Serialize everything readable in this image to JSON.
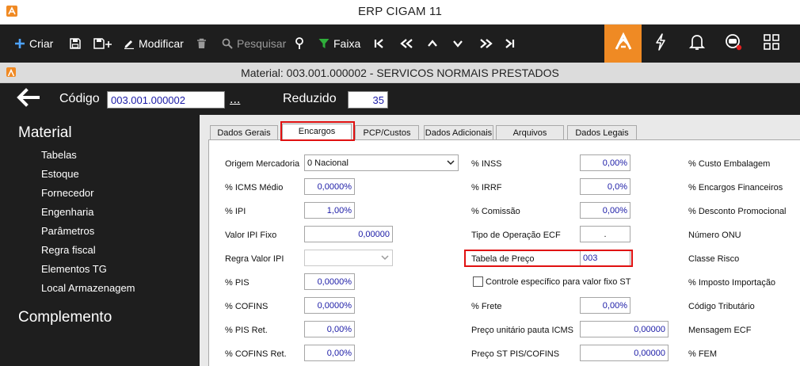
{
  "window": {
    "title": "ERP CIGAM 11"
  },
  "toolbar": {
    "criar": "Criar",
    "modificar": "Modificar",
    "pesquisar": "Pesquisar",
    "faixa": "Faixa",
    "icons": [
      "plus-icon",
      "save-icon",
      "save-add-icon",
      "edit-icon",
      "trash-icon",
      "search-icon",
      "pin-icon",
      "filter-icon",
      "first-icon",
      "prev-fast-icon",
      "up-icon",
      "down-icon",
      "last-icon",
      "cigam-logo-icon",
      "lightning-icon",
      "bell-icon",
      "support-icon",
      "apps-grid-icon"
    ],
    "accent": "#ef8a24"
  },
  "record": {
    "title": "Material: 003.001.000002 - SERVICOS NORMAIS PRESTADOS"
  },
  "codebar": {
    "codigo_label": "Código",
    "codigo_value": "003.001.000002",
    "lookup": "...",
    "reduzido_label": "Reduzido",
    "reduzido_value": "35"
  },
  "sidebar": {
    "section1": "Material",
    "items": [
      "Tabelas",
      "Estoque",
      "Fornecedor",
      "Engenharia",
      "Parâmetros",
      "Regra fiscal",
      "Elementos TG",
      "Local Armazenagem"
    ],
    "section2": "Complemento"
  },
  "tabs": [
    "Dados Gerais",
    "Encargos",
    "PCP/Custos",
    "Dados Adicionais",
    "Arquivos",
    "Dados Legais"
  ],
  "active_tab": "Encargos",
  "form": {
    "col1": {
      "origem_label": "Origem Mercadoria",
      "origem_value": "0 Nacional",
      "icms_label": "% ICMS Médio",
      "icms_value": "0,0000%",
      "ipi_label": "% IPI",
      "ipi_value": "1,00%",
      "ipi_fixo_label": "Valor IPI Fixo",
      "ipi_fixo_value": "0,00000",
      "regra_ipi_label": "Regra Valor IPI",
      "regra_ipi_value": "",
      "pis_label": "% PIS",
      "pis_value": "0,0000%",
      "cofins_label": "% COFINS",
      "cofins_value": "0,0000%",
      "pis_ret_label": "% PIS Ret.",
      "pis_ret_value": "0,00%",
      "cofins_ret_label": "% COFINS Ret.",
      "cofins_ret_value": "0,00%"
    },
    "col2": {
      "inss_label": "% INSS",
      "inss_value": "0,00%",
      "irrf_label": "% IRRF",
      "irrf_value": "0,0%",
      "comissao_label": "% Comissão",
      "comissao_value": "0,00%",
      "tipo_ecf_label": "Tipo de Operação ECF",
      "tipo_ecf_value": ".",
      "tabela_preco_label": "Tabela de Preço",
      "tabela_preco_value": "003",
      "controle_label": "Controle específico para valor fixo ST",
      "frete_label": "% Frete",
      "frete_value": "0,00%",
      "preco_pauta_label": "Preço unitário pauta ICMS",
      "preco_pauta_value": "0,00000",
      "preco_st_label": "Preço ST PIS/COFINS",
      "preco_st_value": "0,00000"
    },
    "col3": {
      "custo_emb": "% Custo Embalagem",
      "encargos_fin": "% Encargos Financeiros",
      "desconto_promo": "% Desconto Promocional",
      "numero_onu": "Número ONU",
      "classe_risco": "Classe Risco",
      "imposto_imp": "% Imposto Importação",
      "codigo_trib": "Código Tributário",
      "mensagem_ecf": "Mensagem ECF",
      "fem": "% FEM"
    }
  }
}
